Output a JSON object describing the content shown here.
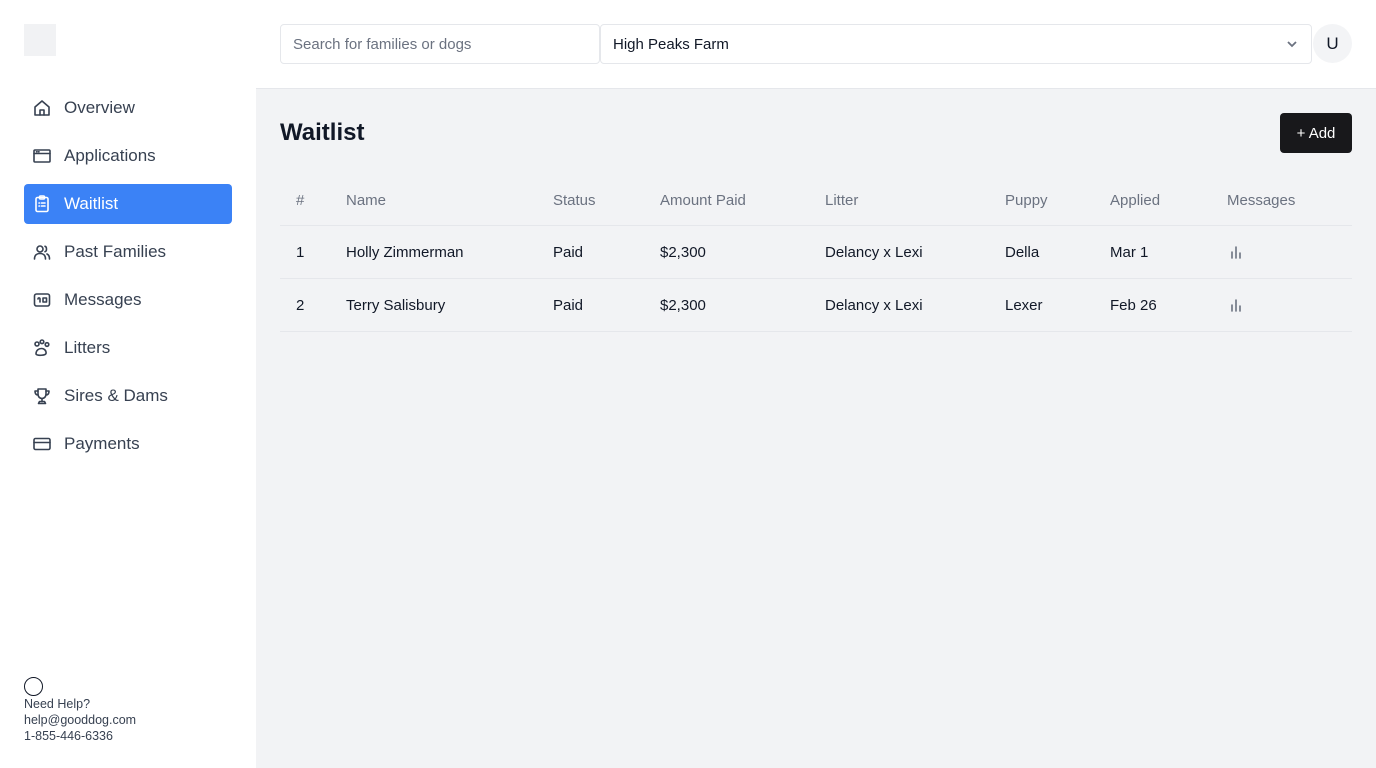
{
  "sidebar": {
    "items": [
      {
        "label": "Overview",
        "icon": "home-icon"
      },
      {
        "label": "Applications",
        "icon": "browser-window-icon"
      },
      {
        "label": "Waitlist",
        "icon": "clipboard-list-icon",
        "active": true
      },
      {
        "label": "Past Families",
        "icon": "users-icon"
      },
      {
        "label": "Messages",
        "icon": "message-icon"
      },
      {
        "label": "Litters",
        "icon": "paw-icon"
      },
      {
        "label": "Sires & Dams",
        "icon": "trophy-icon"
      },
      {
        "label": "Payments",
        "icon": "credit-card-icon"
      }
    ],
    "help": {
      "title": "Need Help?",
      "email": "help@gooddog.com",
      "phone": "1-855-446-6336"
    }
  },
  "topbar": {
    "search_placeholder": "Search for families or dogs",
    "farm_selected": "High Peaks Farm",
    "avatar_initial": "U"
  },
  "main": {
    "title": "Waitlist",
    "add_label": "+ Add",
    "columns": [
      "#",
      "Name",
      "Status",
      "Amount Paid",
      "Litter",
      "Puppy",
      "Applied",
      "Messages"
    ],
    "rows": [
      {
        "num": "1",
        "name": "Holly Zimmerman",
        "status": "Paid",
        "amount": "$2,300",
        "litter": "Delancy x Lexi",
        "puppy": "Della",
        "applied": "Mar 1"
      },
      {
        "num": "2",
        "name": "Terry Salisbury",
        "status": "Paid",
        "amount": "$2,300",
        "litter": "Delancy x Lexi",
        "puppy": "Lexer",
        "applied": "Feb 26"
      }
    ]
  },
  "colors": {
    "accent": "#3b82f6",
    "button_dark": "#18181b",
    "main_bg": "#f2f3f5"
  }
}
